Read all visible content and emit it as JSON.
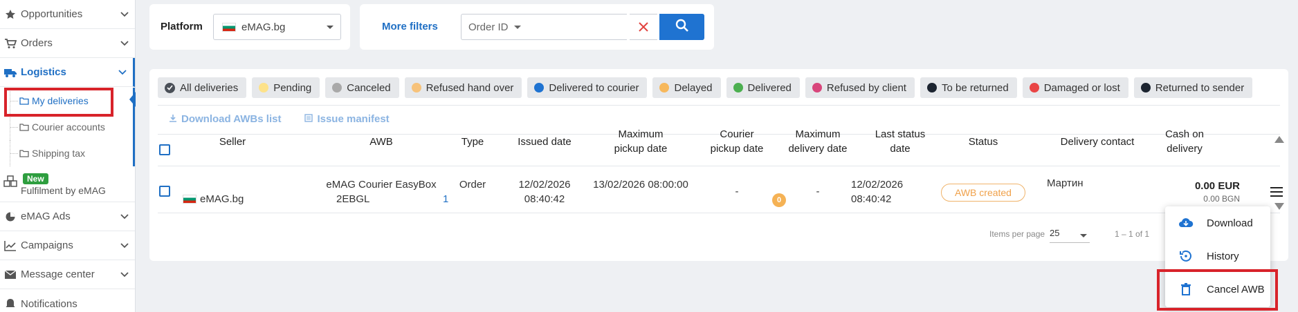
{
  "sidebar": {
    "items": [
      {
        "label": "Opportunities",
        "icon": "star-icon"
      },
      {
        "label": "Orders",
        "icon": "cart-icon"
      },
      {
        "label": "Logistics",
        "icon": "truck-icon"
      },
      {
        "label": "eMAG Ads",
        "icon": "pie-chart-icon"
      },
      {
        "label": "Campaigns",
        "icon": "line-chart-icon"
      },
      {
        "label": "Message center",
        "icon": "envelope-icon"
      },
      {
        "label": "Notifications",
        "icon": "bell-icon"
      }
    ],
    "sub_items": [
      {
        "label": "My deliveries"
      },
      {
        "label": "Courier accounts"
      },
      {
        "label": "Shipping tax"
      }
    ],
    "fulfilment": {
      "badge": "New",
      "label": "Fulfilment by eMAG"
    }
  },
  "filters": {
    "platform_label": "Platform",
    "platform_value": "eMAG.bg",
    "more_filters": "More filters",
    "order_id_placeholder": "Order ID"
  },
  "status_chips": [
    {
      "label": "All deliveries",
      "color": "#4a4f57"
    },
    {
      "label": "Pending",
      "color": "#fde28a"
    },
    {
      "label": "Canceled",
      "color": "#a9a9a9"
    },
    {
      "label": "Refused hand over",
      "color": "#f7c27a"
    },
    {
      "label": "Delivered to courier",
      "color": "#1f73d1"
    },
    {
      "label": "Delayed",
      "color": "#f7b85c"
    },
    {
      "label": "Delivered",
      "color": "#4caf50"
    },
    {
      "label": "Refused by client",
      "color": "#d8457b"
    },
    {
      "label": "To be returned",
      "color": "#1c2430"
    },
    {
      "label": "Damaged or lost",
      "color": "#e94545"
    },
    {
      "label": "Returned to sender",
      "color": "#1c2430"
    }
  ],
  "actions": {
    "download_awbs": "Download AWBs list",
    "issue_manifest": "Issue manifest"
  },
  "table": {
    "headers": {
      "seller": "Seller",
      "awb": "AWB",
      "type": "Type",
      "issued_date": "Issued date",
      "max_pickup_1": "Maximum",
      "max_pickup_2": "pickup date",
      "courier_pickup_1": "Courier",
      "courier_pickup_2": "pickup date",
      "max_delivery_1": "Maximum",
      "max_delivery_2": "delivery date",
      "last_status_1": "Last status",
      "last_status_2": "date",
      "status": "Status",
      "delivery_contact": "Delivery contact",
      "cod_1": "Cash on",
      "cod_2": "delivery"
    },
    "row": {
      "seller": "eMAG.bg",
      "awb_line1": "eMAG Courier EasyBox",
      "awb_line2": "2EBGL",
      "awb_suffix": "1",
      "type": "Order",
      "issued_date": "12/02/2026",
      "issued_time": "08:40:42",
      "max_pickup": "13/02/2026 08:00:00",
      "max_pickup_badge": "0",
      "courier_pickup": "-",
      "max_delivery": "-",
      "last_status_date": "12/02/2026",
      "last_status_time": "08:40:42",
      "status": "AWB created",
      "contact": "Мартин",
      "cod_eur": "0.00 EUR",
      "cod_bgn": "0.00 BGN"
    }
  },
  "pagination": {
    "items_per_page_label": "Items per page",
    "items_per_page": "25",
    "range": "1 – 1 of 1"
  },
  "row_menu": [
    {
      "label": "Download",
      "icon": "cloud-download-icon"
    },
    {
      "label": "History",
      "icon": "history-icon"
    },
    {
      "label": "Cancel AWB",
      "icon": "trash-icon"
    }
  ]
}
